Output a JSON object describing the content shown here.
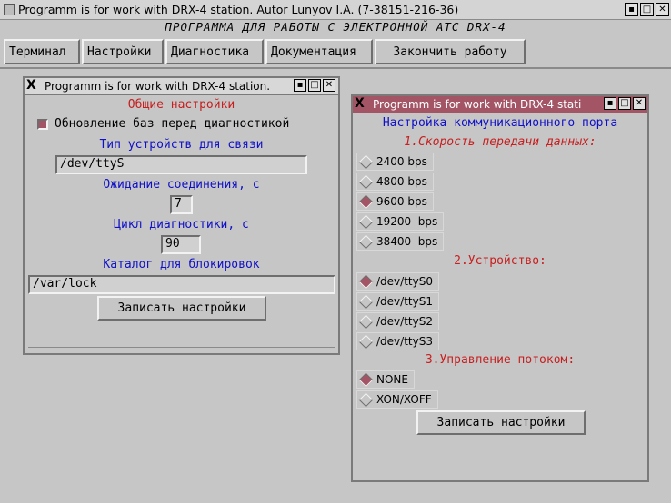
{
  "main": {
    "title": "Programm is for work with DRX-4 station. Autor Lunyov I.A. (7-38151-216-36)",
    "banner": "ПРОГРАММА ДЛЯ РАБОТЫ С ЭЛЕКТРОННОЙ АТС DRX-4",
    "menu": [
      "Терминал",
      "Настройки",
      "Диагностика",
      "Документация",
      "Закончить работу"
    ]
  },
  "general": {
    "title": "Programm is for work with DRX-4 station.",
    "heading": "Общие настройки",
    "update_check": "Обновление баз перед диагностикой",
    "device_type_label": "Тип устройств для связи",
    "device_value": "/dev/ttyS",
    "wait_label": "Ожидание соединения, с",
    "wait_value": "7",
    "cycle_label": "Цикл диагностики, с",
    "cycle_value": "90",
    "lock_label": "Каталог для блокировок",
    "lock_value": "/var/lock",
    "save": "Записать настройки"
  },
  "port": {
    "title": "Programm is for work with DRX-4 stati",
    "heading": "Настройка коммуникационного порта",
    "speed_label": "1.Скорость передачи данных:",
    "speeds": [
      "2400 bps",
      "4800 bps",
      "9600 bps",
      "19200  bps",
      "38400  bps"
    ],
    "device_label": "2.Устройство:",
    "devices": [
      "/dev/ttyS0",
      "/dev/ttyS1",
      "/dev/ttyS2",
      "/dev/ttyS3"
    ],
    "flow_label": "3.Управление потоком:",
    "flows": [
      "NONE",
      "XON/XOFF"
    ],
    "save": "Записать настройки"
  },
  "colors": {
    "selected": "#a35565",
    "blue_label": "#1010c8",
    "red_label": "#c81e1e"
  }
}
